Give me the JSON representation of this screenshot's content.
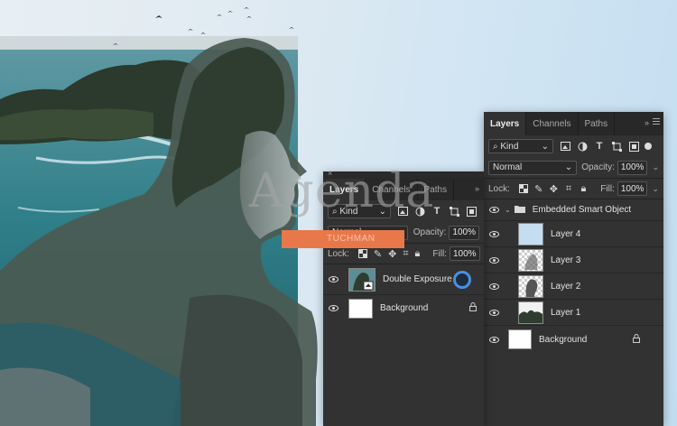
{
  "background": {
    "colors": {
      "sky": "#cfe4f3",
      "sea": "#2e7d86",
      "trees": "#2c3a2c"
    }
  },
  "overlay": {
    "watermark": "Agenda",
    "badge_text": "TUCHMAN",
    "badge_color": "#e8784a"
  },
  "panel_front": {
    "tabs": [
      "Layers",
      "Channels",
      "Paths"
    ],
    "kind": "Kind",
    "blend_mode": "Normal",
    "opacity_label": "Opacity:",
    "opacity_value": "100%",
    "lock_label": "Lock:",
    "fill_label": "Fill:",
    "fill_value": "100%",
    "layers": [
      {
        "name": "Double Exposure",
        "icon": "smart-object-thumb",
        "selected": true
      },
      {
        "name": "Background",
        "icon": "white-thumb",
        "locked": true
      }
    ]
  },
  "panel_back": {
    "tabs": [
      "Layers",
      "Channels",
      "Paths"
    ],
    "kind": "Kind",
    "blend_mode": "Normal",
    "opacity_label": "Opacity:",
    "opacity_value": "100%",
    "lock_label": "Lock:",
    "fill_label": "Fill:",
    "fill_value": "100%",
    "group_name": "Embedded Smart Object",
    "layers": [
      {
        "name": "Layer 4",
        "icon": "blue-thumb"
      },
      {
        "name": "Layer 3",
        "icon": "transparent-thumb"
      },
      {
        "name": "Layer 2",
        "icon": "portrait-thumb"
      },
      {
        "name": "Layer 1",
        "icon": "trees-thumb"
      },
      {
        "name": "Background",
        "icon": "white-thumb",
        "locked": true
      }
    ]
  }
}
